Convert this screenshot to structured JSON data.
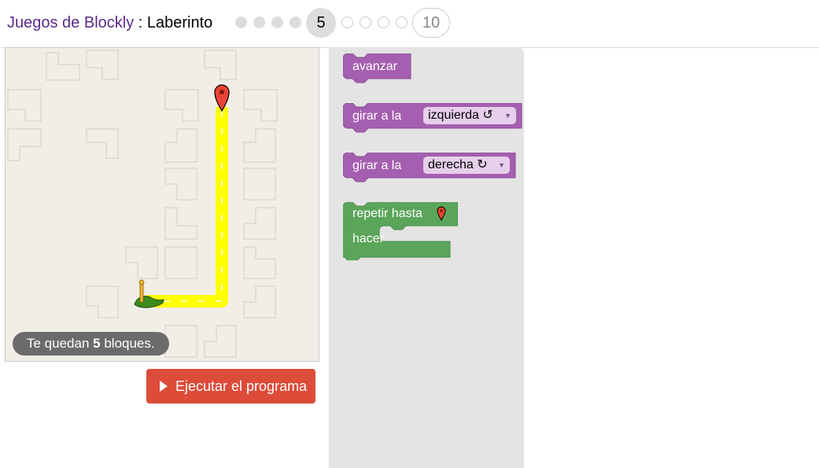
{
  "header": {
    "app_name": "Juegos de Blockly",
    "separator": " : ",
    "game_name": "Laberinto",
    "current_level": "5",
    "last_level": "10"
  },
  "capacity": {
    "prefix": "Te quedan ",
    "count": "5",
    "suffix": " bloques."
  },
  "run_button": {
    "label": "Ejecutar el programa"
  },
  "toolbox": {
    "move_forward": "avanzar",
    "turn_left": {
      "label": "girar a la",
      "option": "izquierda ↺"
    },
    "turn_right": {
      "label": "girar a la",
      "option": "derecha ↻"
    },
    "repeat": {
      "label": "repetir hasta",
      "do_label": "hacer"
    }
  },
  "colors": {
    "movement_block": "#a55fb0",
    "loop_block": "#5ba55b",
    "path": "#ffff00",
    "run_button": "#dd4b39",
    "maze_bg": "#f1eee7"
  }
}
